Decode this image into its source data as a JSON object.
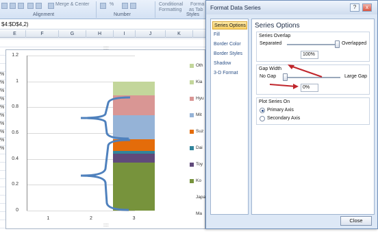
{
  "ribbon": {
    "merge_center_label": "Merge & Center",
    "percent_sign": "%",
    "conditional_label": "Conditional",
    "formatting_label": "Formatting",
    "format_label": "Forma",
    "as_table_label": "as Tab",
    "alignment_label": "Alignment",
    "number_label": "Number",
    "styles_label": "Styles"
  },
  "formula_bar": {
    "text": "$4:$D$4,2)"
  },
  "columns": [
    "E",
    "F",
    "G",
    "H",
    "I",
    "J",
    "K"
  ],
  "row_edge_labels": [
    "%",
    "%",
    "%",
    "%",
    "%",
    "%",
    "%",
    "%",
    "%",
    "%"
  ],
  "chart_data": {
    "type": "bar",
    "stacked": true,
    "categories": [
      "1",
      "2",
      "3"
    ],
    "ylim": [
      0,
      1.2
    ],
    "yticks": [
      "1.2",
      "1",
      "0.8",
      "0.6",
      "0.4",
      "0.2",
      "0"
    ],
    "series": [
      {
        "name": "Ko",
        "values": [
          0,
          0,
          0.37
        ],
        "color": "#77933c"
      },
      {
        "name": "Toy",
        "values": [
          0,
          0,
          0.07
        ],
        "color": "#604a7b"
      },
      {
        "name": "Dai",
        "values": [
          0,
          0,
          0.02
        ],
        "color": "#31859c"
      },
      {
        "name": "Suz",
        "values": [
          0,
          0,
          0.09
        ],
        "color": "#e46c0a"
      },
      {
        "name": "Mit",
        "values": [
          0,
          0,
          0.19
        ],
        "color": "#95b3d7"
      },
      {
        "name": "Hyu",
        "values": [
          0,
          0,
          0.15
        ],
        "color": "#d99694"
      },
      {
        "name": "Kia",
        "values": [
          0,
          0,
          0.11
        ],
        "color": "#c3d69b"
      }
    ],
    "legend": [
      "Oth",
      "Kia",
      "Hyu",
      "Mit",
      "Suz",
      "Dai",
      "Toy",
      "Ko",
      "Japa",
      "Ma"
    ]
  },
  "dialog": {
    "title": "Format Data Series",
    "help_label": "?",
    "close_x_label": "x",
    "nav_items": [
      "Series Options",
      "Fill",
      "Border Color",
      "Border Styles",
      "Shadow",
      "3-D Format"
    ],
    "panel_title": "Series Options",
    "overlap": {
      "label": "Series Overlap",
      "left_label": "Separated",
      "right_label": "Overlapped",
      "value": "100%",
      "level": 1.0
    },
    "gap": {
      "label": "Gap Width",
      "left_label": "No Gap",
      "right_label": "Large Gap",
      "value": "0%",
      "level": 0.0
    },
    "plot_on": {
      "label": "Plot Series On",
      "options": [
        "Primary Axis",
        "Secondary Axis"
      ],
      "selected": "Primary Axis"
    },
    "close_button": "Close"
  },
  "colors": {
    "annotation_arrow": "#c0262c",
    "brace": "#4f81bd"
  }
}
